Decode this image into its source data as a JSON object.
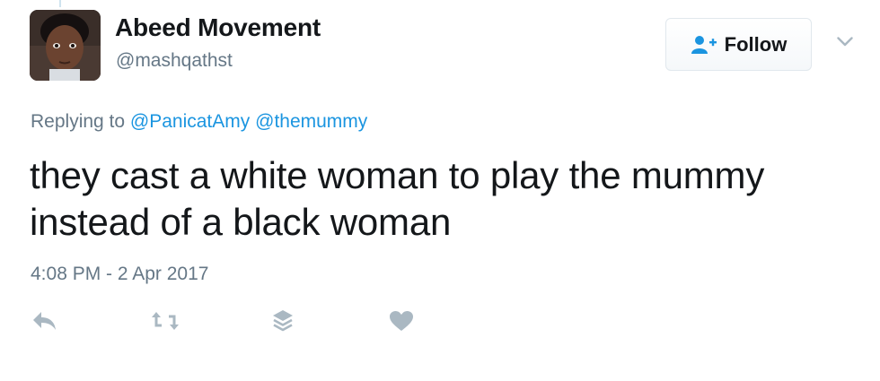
{
  "user": {
    "display_name": "Abeed Movement",
    "username": "@mashqathst"
  },
  "follow_button": {
    "label": "Follow"
  },
  "reply_context": {
    "prefix": "Replying to",
    "mentions": [
      "@PanicatAmy",
      "@themummy"
    ]
  },
  "tweet": {
    "text": "they cast a white woman to play the mummy instead of a black woman",
    "timestamp": "4:08 PM - 2 Apr 2017"
  },
  "icons": {
    "follow": "add-user-icon",
    "more": "chevron-down-icon",
    "reply": "reply-icon",
    "retweet": "retweet-icon",
    "stack": "layers-icon",
    "like": "heart-icon"
  },
  "colors": {
    "text": "#14171a",
    "secondary_text": "#657786",
    "link": "#1b95e0",
    "icon": "#aab8c2",
    "follow_icon": "#1b95e0"
  }
}
